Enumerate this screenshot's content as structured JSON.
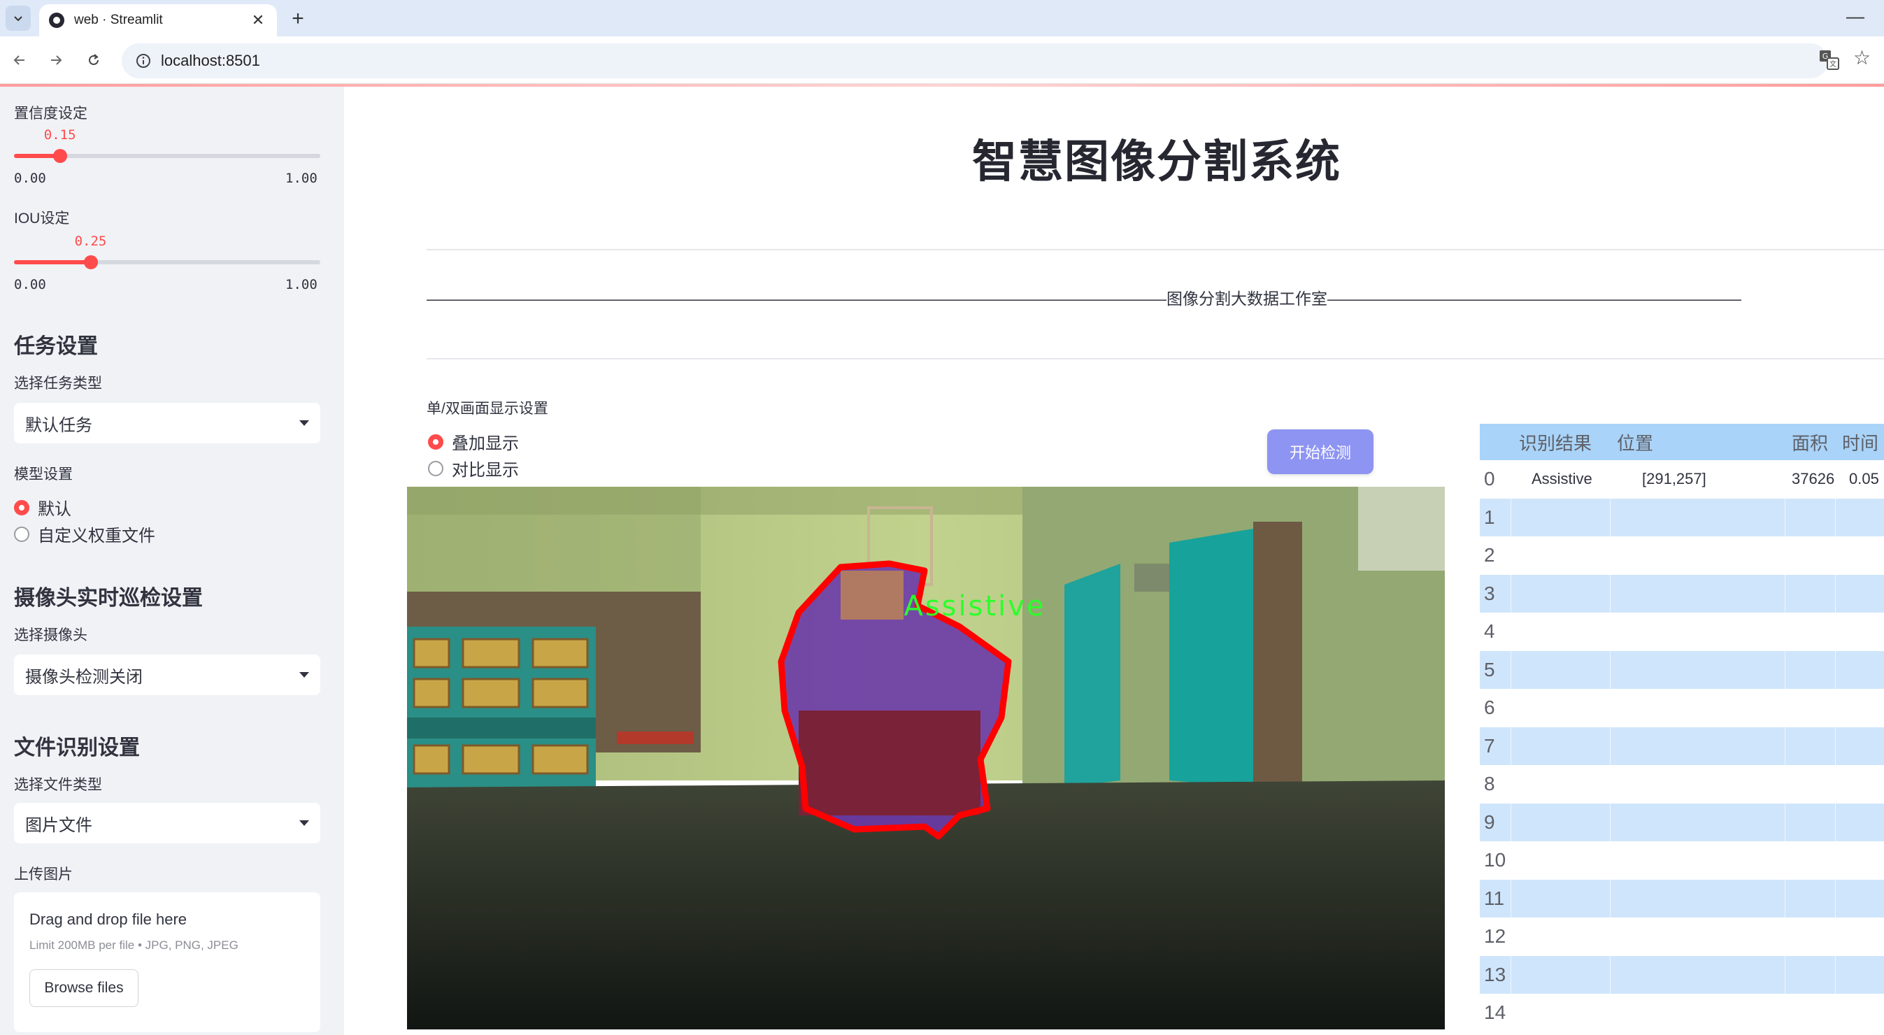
{
  "browser": {
    "tab_title": "web · Streamlit",
    "url": "localhost:8501",
    "new_tab_glyph": "+",
    "close_glyph": "✕"
  },
  "sidebar": {
    "confidence": {
      "label": "置信度设定",
      "value": 0.15,
      "value_text": "0.15",
      "min": "0.00",
      "max": "1.00"
    },
    "iou": {
      "label": "IOU设定",
      "value": 0.25,
      "value_text": "0.25",
      "min": "0.00",
      "max": "1.00"
    },
    "task_heading": "任务设置",
    "task_type_label": "选择任务类型",
    "task_type_value": "默认任务",
    "model_label": "模型设置",
    "model_options": [
      "默认",
      "自定义权重文件"
    ],
    "model_selected": "默认",
    "camera_heading": "摄像头实时巡检设置",
    "camera_label": "选择摄像头",
    "camera_value": "摄像头检测关闭",
    "file_heading": "文件识别设置",
    "file_type_label": "选择文件类型",
    "file_type_value": "图片文件",
    "upload_label": "上传图片",
    "uploader_title": "Drag and drop file here",
    "uploader_limit": "Limit 200MB per file • JPG, PNG, JPEG",
    "browse_label": "Browse files"
  },
  "main": {
    "title": "智慧图像分割系统",
    "subtitle": "——————————————————————————————————————————————图像分割大数据工作室——————————————————————————————————————————————",
    "display_label": "单/双画面显示设置",
    "display_options": [
      "叠加显示",
      "对比显示"
    ],
    "display_selected": "叠加显示",
    "start_button": "开始检测",
    "detection_label": "Assistive"
  },
  "table": {
    "columns": [
      "识别结果",
      "位置",
      "面积",
      "时间"
    ],
    "rows": [
      {
        "index": "0",
        "result": "Assistive",
        "position": "[291,257]",
        "area": "37626",
        "time": "0.05"
      },
      {
        "index": "1"
      },
      {
        "index": "2"
      },
      {
        "index": "3"
      },
      {
        "index": "4"
      },
      {
        "index": "5"
      },
      {
        "index": "6"
      },
      {
        "index": "7"
      },
      {
        "index": "8"
      },
      {
        "index": "9"
      },
      {
        "index": "10"
      },
      {
        "index": "11"
      },
      {
        "index": "12"
      },
      {
        "index": "13"
      },
      {
        "index": "14"
      }
    ]
  },
  "colors": {
    "accent": "#ff4b4b",
    "button": "#8e94f2",
    "table_header": "#a9d3f8",
    "table_stripe": "#cfe5fb",
    "mask_outline": "#ff0000",
    "label_text": "#2bff2b"
  }
}
